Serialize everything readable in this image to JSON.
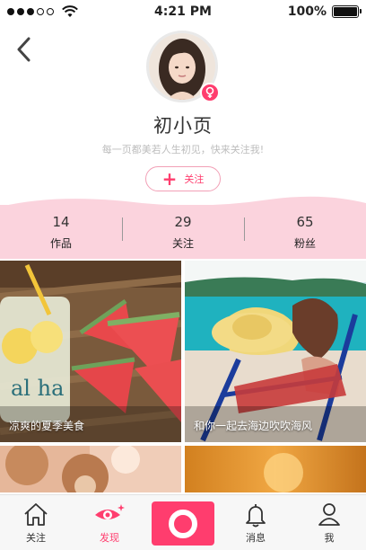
{
  "status_bar": {
    "time": "4:21 PM",
    "battery": "100%",
    "signal_icon": "signal-dots-icon",
    "wifi_icon": "wifi-icon",
    "battery_icon": "battery-icon"
  },
  "header": {
    "back_icon": "chevron-left-icon",
    "avatar_icon": "avatar",
    "gender_icon": "female-icon",
    "username": "初小页",
    "bio": "每一页都美若人生初见，快来关注我!",
    "follow_label": "关注",
    "follow_icon": "plus-icon"
  },
  "stats": [
    {
      "count": "14",
      "label": "作品"
    },
    {
      "count": "29",
      "label": "关注"
    },
    {
      "count": "65",
      "label": "粉丝"
    }
  ],
  "posts": [
    {
      "caption": "凉爽的夏季美食"
    },
    {
      "caption": "和你一起去海边吹吹海风"
    },
    {
      "caption": ""
    },
    {
      "caption": ""
    }
  ],
  "tab_bar": {
    "tabs": [
      {
        "label": "关注",
        "icon": "home-icon",
        "active": false
      },
      {
        "label": "发现",
        "icon": "eye-icon",
        "active": true
      },
      {
        "label": "",
        "icon": "record-icon",
        "active": false
      },
      {
        "label": "消息",
        "icon": "bell-icon",
        "active": false
      },
      {
        "label": "我",
        "icon": "person-icon",
        "active": false
      }
    ]
  },
  "colors": {
    "accent": "#ff3d6e",
    "stats_background": "#fbd3dd",
    "tab_background": "#f7f7f7"
  }
}
